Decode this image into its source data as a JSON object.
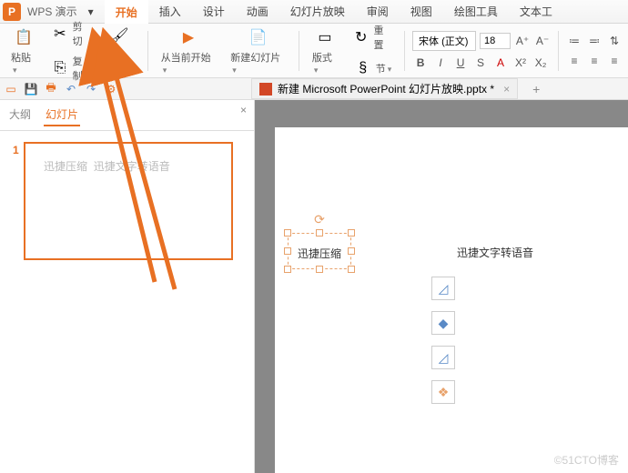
{
  "app": {
    "name": "WPS 演示",
    "badge": "P"
  },
  "tabs": {
    "items": [
      "开始",
      "插入",
      "设计",
      "动画",
      "幻灯片放映",
      "审阅",
      "视图",
      "绘图工具",
      "文本工"
    ],
    "active_index": 0,
    "menu": "▾"
  },
  "ribbon": {
    "paste": {
      "label": "粘贴",
      "icon": "📋"
    },
    "cut": {
      "label": "剪切",
      "icon": "✂"
    },
    "copy": {
      "label": "复制",
      "icon": "⎘"
    },
    "format_painter": {
      "label": "格式刷",
      "icon": "🖌"
    },
    "from_current": {
      "label": "从当前开始",
      "icon": "▶"
    },
    "new_slide": {
      "label": "新建幻灯片",
      "icon": "📄"
    },
    "layout": {
      "label": "版式",
      "icon": "▭"
    },
    "reset": {
      "label": "重置",
      "icon": "↻"
    },
    "section": {
      "label": "节",
      "icon": "§"
    },
    "font_name": "宋体 (正文)",
    "font_size": "18",
    "font_btns": {
      "bigger": "A⁺",
      "smaller": "A⁻",
      "clear": "A"
    },
    "style_btns": [
      "B",
      "I",
      "U",
      "S",
      "A",
      "X²",
      "X₂"
    ],
    "align_icons": [
      "≡",
      "≡",
      "≡"
    ]
  },
  "qat": {
    "icons": [
      "▭",
      "💾",
      "🖶",
      "↶",
      "↷",
      "⚙"
    ]
  },
  "file_tab": {
    "title": "新建 Microsoft PowerPoint 幻灯片放映.pptx *",
    "close": "×",
    "plus": "+"
  },
  "leftpane": {
    "tabs": [
      "大纲",
      "幻灯片"
    ],
    "active": 1,
    "close": "×",
    "slide_num": "1",
    "thumb_text1": "迅捷压缩",
    "thumb_text2": "迅捷文字转语音"
  },
  "slide": {
    "text1": "迅捷压缩",
    "text2": "迅捷文字转语音"
  },
  "sidetools": {
    "icons": [
      "◿",
      "◆",
      "◿",
      "❖"
    ]
  },
  "watermark": "©51CTO博客"
}
